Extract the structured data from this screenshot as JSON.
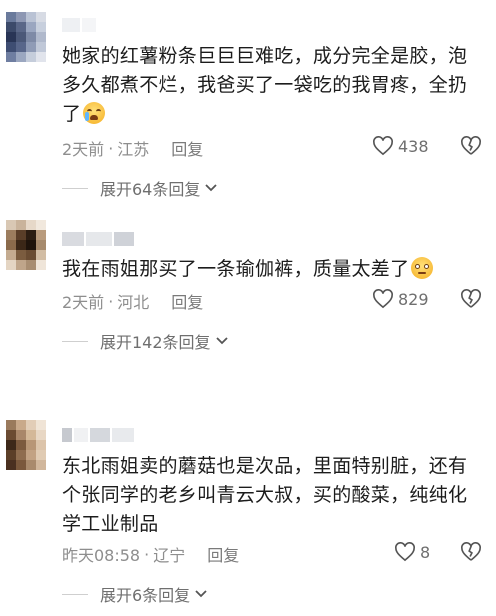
{
  "comments": [
    {
      "text": "她家的红薯粉条巨巨巨难吃，成分完全是胶，泡多久都煮不烂，我爸买了一袋吃的我胃疼，全扔了",
      "emoji": "loudly-crying-face-emoji",
      "time": "2天前",
      "location": "江苏",
      "reply_label": "回复",
      "likes": "438",
      "expand_label": "展开64条回复",
      "avatar_colors": [
        "#6a7a9c",
        "#8d97b3",
        "#b9c2d4",
        "#d7dbe4",
        "#3c4a6a",
        "#5a6788",
        "#9aa6c0",
        "#c7cfdd",
        "#293556",
        "#4b5878",
        "#7e8aa6",
        "#b0b9cc",
        "#3e4d72",
        "#58668a",
        "#8f9bb6",
        "#c0c8d8",
        "#6f7ea1",
        "#9ba7c0",
        "#c5cddb",
        "#e1e4ec"
      ]
    },
    {
      "text": "我在雨姐那买了一条瑜伽裤，质量太差了",
      "emoji": "grimacing-face-emoji",
      "time": "2天前",
      "location": "河北",
      "reply_label": "回复",
      "likes": "829",
      "expand_label": "展开142条回复",
      "avatar_colors": [
        "#d9c8b4",
        "#c9b39b",
        "#e6d8c8",
        "#f1e8dd",
        "#9c7d5e",
        "#5a3e28",
        "#2c1d12",
        "#b99b7d",
        "#8a6a4b",
        "#3b2717",
        "#1e130b",
        "#a68a6d",
        "#c4ab90",
        "#7b5c3f",
        "#6a4c32",
        "#d2bda4",
        "#e4d5c3",
        "#bfa58a",
        "#a88d71",
        "#efe5d9"
      ]
    },
    {
      "text": "东北雨姐卖的蘑菇也是次品，里面特别脏，还有个张同学的老乡叫青云大叔，买的酸菜，纯纯化学工业制品",
      "emoji": "",
      "time": "昨天08:58",
      "location": "辽宁",
      "reply_label": "回复",
      "likes": "8",
      "expand_label": "展开6条回复",
      "avatar_colors": [
        "#9a7a5c",
        "#c9a98a",
        "#e2cdb7",
        "#f0e4d6",
        "#6b4b32",
        "#a9876a",
        "#d4b898",
        "#e8d7c4",
        "#3d2819",
        "#7c5a3e",
        "#b89676",
        "#dcc4aa",
        "#5c3f28",
        "#8f6d4f",
        "#c2a283",
        "#e0cbb3",
        "#4a3020",
        "#7a583c",
        "#a98a6c",
        "#d1b79c"
      ]
    }
  ],
  "username_blur_colors": [
    "#d4d6db",
    "#e3e5e8",
    "#c8cbd1",
    "#eceef1"
  ]
}
